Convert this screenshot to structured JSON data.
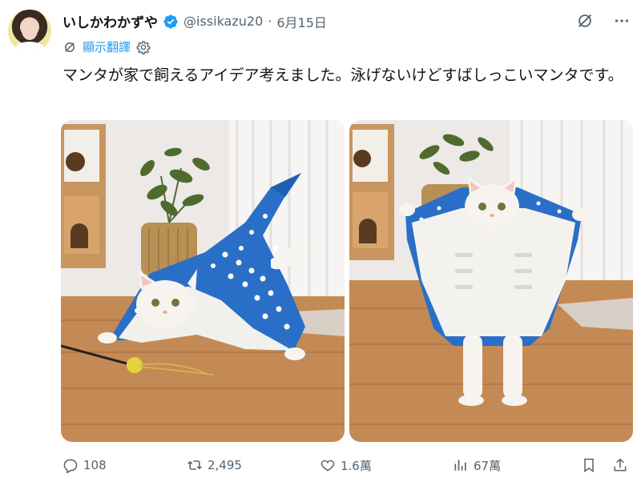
{
  "author": {
    "display_name": "いしかわかずや",
    "handle": "@issikazu20",
    "separator": "·",
    "date": "6月15日"
  },
  "translate": {
    "label": "顯示翻譯"
  },
  "tweet": {
    "text": "マンタが家で飼えるアイデア考えました。泳げないけどすばしっこいマンタです。"
  },
  "media": [
    {
      "description_icon": "photo-manta-cat-crouching"
    },
    {
      "description_icon": "photo-manta-cat-standing"
    }
  ],
  "actions": {
    "replies": "108",
    "retweets": "2,495",
    "likes": "1.6萬",
    "views": "67萬"
  },
  "colors": {
    "accent": "#1d9bf0",
    "secondary_text": "#536471",
    "primary_text": "#0f1419"
  }
}
